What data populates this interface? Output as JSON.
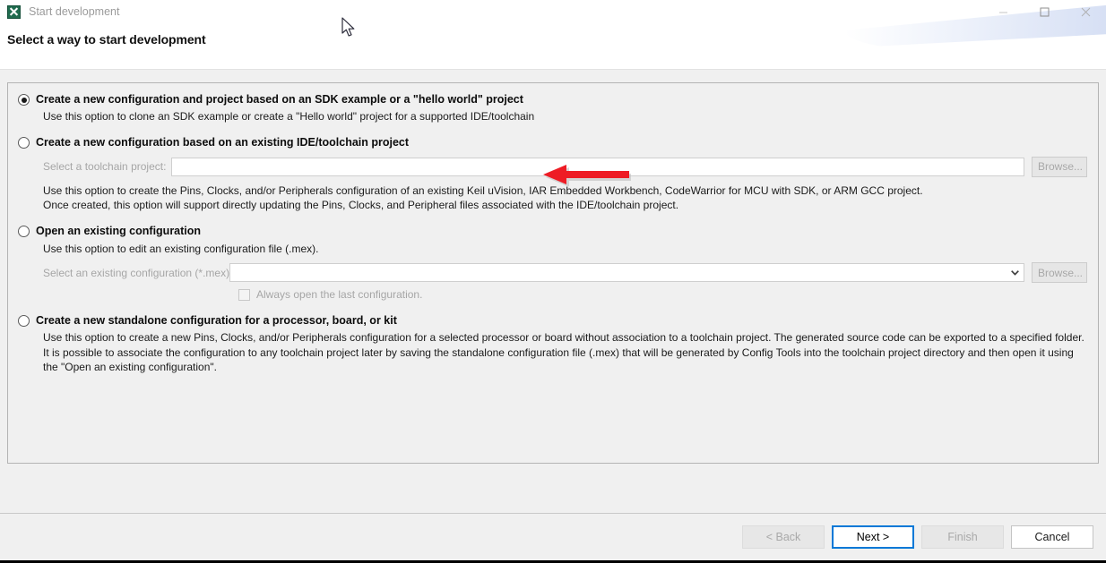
{
  "window": {
    "app_icon": "x-logo-icon",
    "title": "Start development",
    "controls": {
      "minimize": "minimize-icon",
      "maximize": "maximize-icon",
      "close": "close-icon"
    }
  },
  "header": {
    "page_title": "Select a way to start development"
  },
  "annotation": {
    "arrow": "red-left-arrow",
    "color": "#ed1c24"
  },
  "cursor": "arrow-pointer",
  "options": [
    {
      "id": "sdk-example",
      "label": "Create a new configuration and project based on an SDK example or a \"hello world\" project",
      "selected": true,
      "description": "Use this option to clone an SDK example or create a \"Hello world\" project for a supported IDE/toolchain"
    },
    {
      "id": "existing-toolchain",
      "label": "Create a new configuration based on an existing IDE/toolchain project",
      "selected": false,
      "field_label": "Select a toolchain project:",
      "field_value": "",
      "field_placeholder": "",
      "browse_label": "Browse...",
      "description_line1": "Use this option to create the Pins, Clocks, and/or Peripherals configuration of an existing Keil uVision, IAR Embedded Workbench, CodeWarrior for MCU with SDK, or ARM GCC project.",
      "description_line2": "Once created, this option will support directly updating the Pins, Clocks, and Peripheral files associated with the IDE/toolchain project."
    },
    {
      "id": "open-existing",
      "label": "Open an existing configuration",
      "selected": false,
      "description": "Use this option to edit an existing configuration file (.mex).",
      "field_label": "Select an existing configuration (*.mex)",
      "field_value": "",
      "browse_label": "Browse...",
      "checkbox_label": "Always open the last configuration.",
      "checkbox_checked": false
    },
    {
      "id": "standalone",
      "label": "Create a new standalone configuration for a processor, board, or kit",
      "selected": false,
      "description": "Use this option to create a new Pins, Clocks, and/or Peripherals configuration for a selected processor or board without association to a toolchain project. The generated source code can be exported to a specified folder. It is possible to associate the configuration to any toolchain project later by saving the standalone configuration file (.mex) that will be generated by Config Tools into the toolchain project directory and then open it using the \"Open an existing configuration\"."
    }
  ],
  "footer": {
    "back": "< Back",
    "next": "Next >",
    "finish": "Finish",
    "cancel": "Cancel"
  }
}
